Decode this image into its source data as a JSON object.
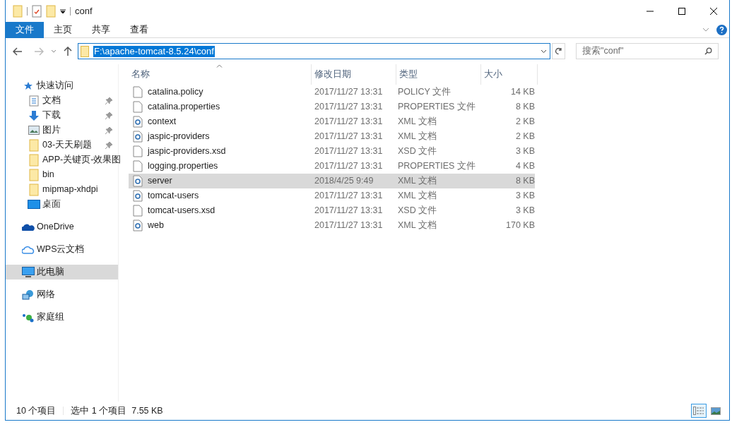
{
  "window": {
    "title": "conf"
  },
  "ribbon_tabs": [
    {
      "label": "文件",
      "selected": true
    },
    {
      "label": "主页",
      "selected": false
    },
    {
      "label": "共享",
      "selected": false
    },
    {
      "label": "查看",
      "selected": false
    }
  ],
  "address": {
    "value": "F:\\apache-tomcat-8.5.24\\conf"
  },
  "search": {
    "placeholder": "搜索\"conf\""
  },
  "sidebar": {
    "items": [
      {
        "label": "快速访问",
        "kind": "star",
        "pinned": false,
        "selected": false,
        "children": [
          {
            "label": "文档",
            "kind": "docs",
            "pinned": true,
            "selected": false
          },
          {
            "label": "下载",
            "kind": "download",
            "pinned": true,
            "selected": false
          },
          {
            "label": "图片",
            "kind": "pictures",
            "pinned": true,
            "selected": false
          },
          {
            "label": "03-天天刷题",
            "kind": "folder",
            "pinned": true,
            "selected": false
          },
          {
            "label": "APP-关键页-效果图",
            "kind": "folder",
            "pinned": false,
            "selected": false
          },
          {
            "label": "bin",
            "kind": "folder",
            "pinned": false,
            "selected": false
          },
          {
            "label": "mipmap-xhdpi",
            "kind": "folder",
            "pinned": false,
            "selected": false
          },
          {
            "label": "桌面",
            "kind": "desktop",
            "pinned": false,
            "selected": false
          }
        ]
      },
      {
        "label": "OneDrive",
        "kind": "cloud",
        "pinned": false,
        "selected": false
      },
      {
        "label": "WPS云文档",
        "kind": "cloud-outline",
        "pinned": false,
        "selected": false
      },
      {
        "label": "此电脑",
        "kind": "pc",
        "pinned": false,
        "selected": true
      },
      {
        "label": "网络",
        "kind": "network",
        "pinned": false,
        "selected": false
      },
      {
        "label": "家庭组",
        "kind": "homegroup",
        "pinned": false,
        "selected": false
      }
    ]
  },
  "table": {
    "columns": [
      "名称",
      "修改日期",
      "类型",
      "大小"
    ],
    "rows": [
      {
        "name": "catalina.policy",
        "date": "2017/11/27 13:31",
        "type": "POLICY 文件",
        "size": "14 KB",
        "kind": "file",
        "selected": false
      },
      {
        "name": "catalina.properties",
        "date": "2017/11/27 13:31",
        "type": "PROPERTIES 文件",
        "size": "8 KB",
        "kind": "file",
        "selected": false
      },
      {
        "name": "context",
        "date": "2017/11/27 13:31",
        "type": "XML 文档",
        "size": "2 KB",
        "kind": "xml",
        "selected": false
      },
      {
        "name": "jaspic-providers",
        "date": "2017/11/27 13:31",
        "type": "XML 文档",
        "size": "2 KB",
        "kind": "xml",
        "selected": false
      },
      {
        "name": "jaspic-providers.xsd",
        "date": "2017/11/27 13:31",
        "type": "XSD 文件",
        "size": "3 KB",
        "kind": "file",
        "selected": false
      },
      {
        "name": "logging.properties",
        "date": "2017/11/27 13:31",
        "type": "PROPERTIES 文件",
        "size": "4 KB",
        "kind": "file",
        "selected": false
      },
      {
        "name": "server",
        "date": "2018/4/25 9:49",
        "type": "XML 文档",
        "size": "8 KB",
        "kind": "xml",
        "selected": true
      },
      {
        "name": "tomcat-users",
        "date": "2017/11/27 13:31",
        "type": "XML 文档",
        "size": "3 KB",
        "kind": "xml",
        "selected": false
      },
      {
        "name": "tomcat-users.xsd",
        "date": "2017/11/27 13:31",
        "type": "XSD 文件",
        "size": "3 KB",
        "kind": "file",
        "selected": false
      },
      {
        "name": "web",
        "date": "2017/11/27 13:31",
        "type": "XML 文档",
        "size": "170 KB",
        "kind": "xml",
        "selected": false
      }
    ]
  },
  "status_bar": {
    "count": "10 个项目",
    "selection": "选中 1 个项目  7.55 KB"
  },
  "view_buttons": [
    {
      "kind": "details",
      "selected": true
    },
    {
      "kind": "thumbnails",
      "selected": false
    }
  ]
}
